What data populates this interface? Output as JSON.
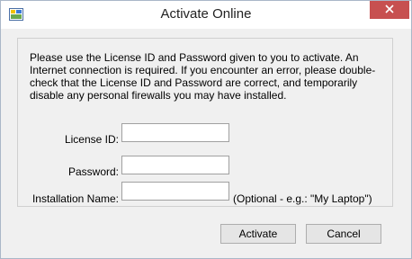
{
  "window": {
    "title": "Activate Online",
    "app_icon": "app-icon",
    "close_icon": "close-icon"
  },
  "intro_text": "Please use the License ID and Password given to you to activate.  An Internet connection is required.  If you encounter an error, please double-check that the License ID and Password are correct, and temporarily disable any personal firewalls you may have installed.",
  "form": {
    "license_label": "License ID:",
    "license_value": "",
    "password_label": "Password:",
    "password_value": "",
    "installation_label": "Installation Name:",
    "installation_value": "",
    "installation_hint": "(Optional - e.g.: \"My Laptop\")"
  },
  "buttons": {
    "activate": "Activate",
    "cancel": "Cancel"
  },
  "colors": {
    "close_button": "#c75050",
    "window_bg": "#f0f0f0"
  }
}
